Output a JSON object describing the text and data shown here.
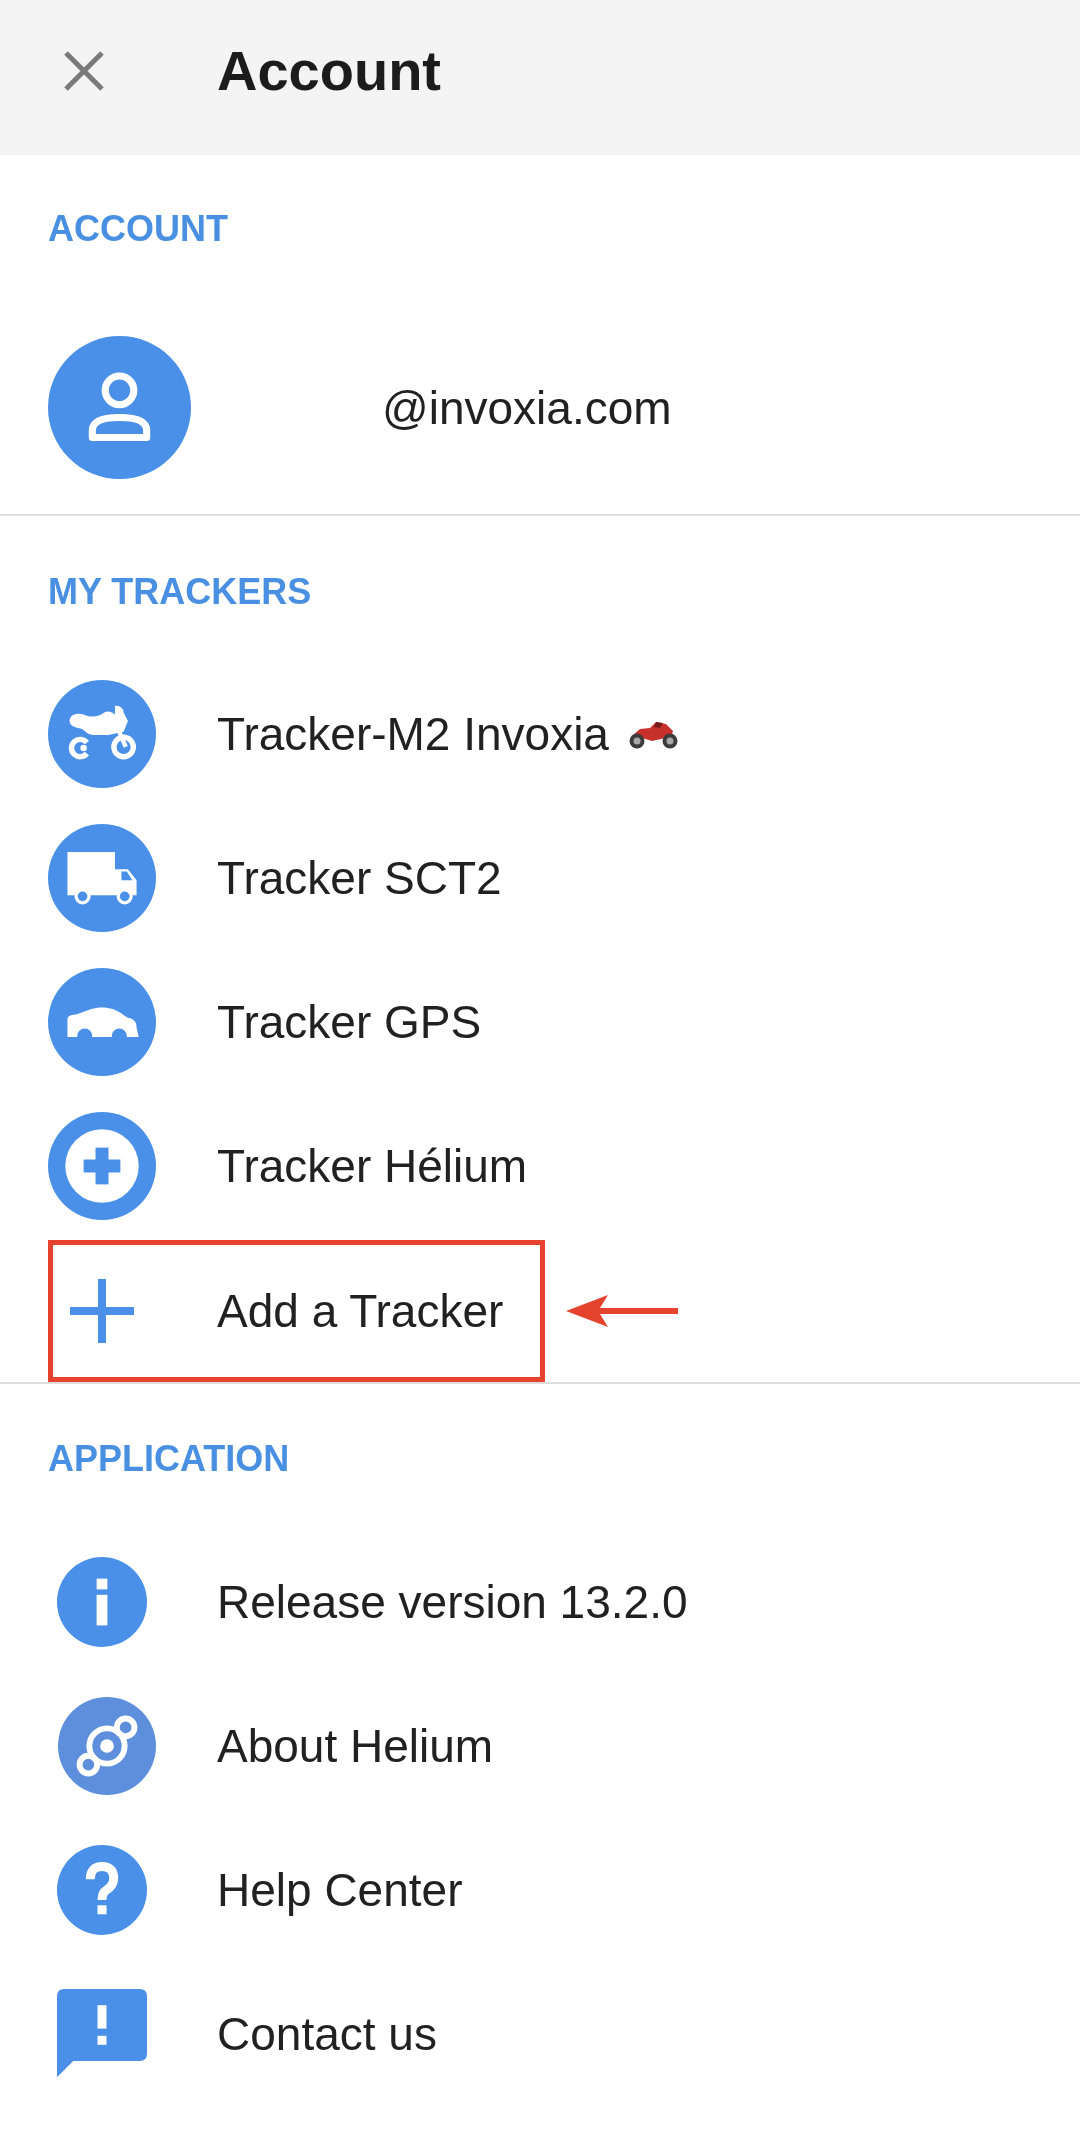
{
  "header": {
    "title": "Account"
  },
  "account_section": {
    "heading": "ACCOUNT",
    "email": "@invoxia.com"
  },
  "trackers_section": {
    "heading": "MY TRACKERS",
    "trackers": [
      {
        "name": "Tracker-M2 Invoxia"
      },
      {
        "name": "Tracker SCT2"
      },
      {
        "name": "Tracker GPS"
      },
      {
        "name": "Tracker Hélium"
      }
    ],
    "add_tracker": {
      "label": "Add a Tracker",
      "highlighted": true
    }
  },
  "application_section": {
    "heading": "APPLICATION",
    "items": [
      {
        "label": "Release version 13.2.0"
      },
      {
        "label": "About Helium"
      },
      {
        "label": "Help Center"
      },
      {
        "label": "Contact us"
      }
    ]
  }
}
